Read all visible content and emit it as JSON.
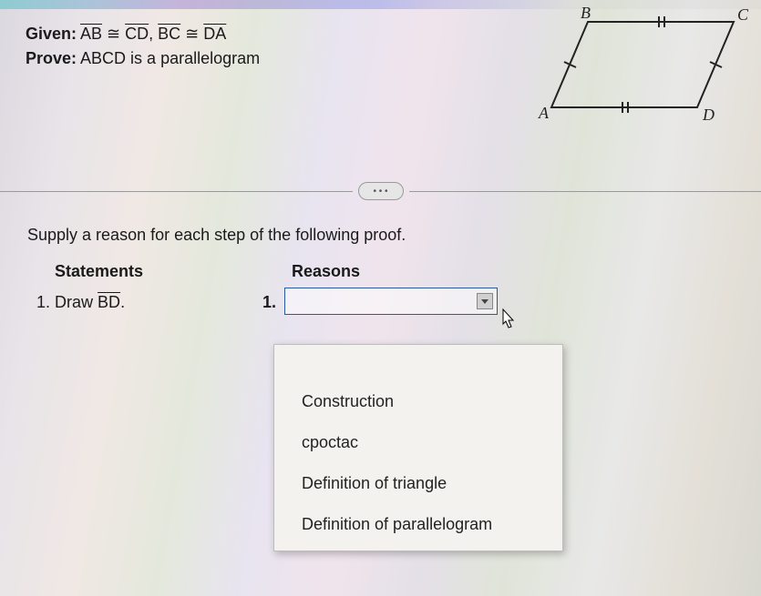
{
  "given_label": "Given:",
  "given_text_parts": {
    "ab": "AB",
    "cd": "CD",
    "bc": "BC",
    "da": "DA"
  },
  "given_joiner1": " ≅ ",
  "given_joiner2": ", ",
  "prove_label": "Prove:",
  "prove_text": "ABCD is a parallelogram",
  "figure": {
    "A": "A",
    "B": "B",
    "C": "C",
    "D": "D"
  },
  "more_label": "• • •",
  "instruction": "Supply a reason for each step of the following proof.",
  "headers": {
    "statements": "Statements",
    "reasons": "Reasons"
  },
  "step1": {
    "num": "1.",
    "text_prefix": "Draw ",
    "seg": "BD",
    "text_suffix": "."
  },
  "reason1": {
    "num": "1.",
    "value": ""
  },
  "dropdown_options": [
    "Construction",
    "cpoctac",
    "Definition of triangle",
    "Definition of parallelogram"
  ]
}
